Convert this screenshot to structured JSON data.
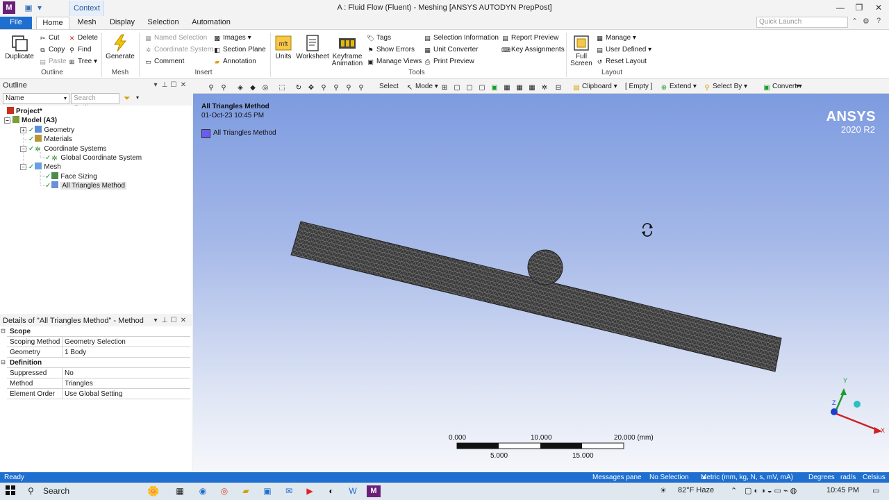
{
  "window": {
    "title": "A : Fluid Flow (Fluent) - Meshing [ANSYS AUTODYN PrepPost]",
    "context_tab": "Context",
    "app_logo": "M"
  },
  "ribbon_tabs": [
    "File",
    "Home",
    "Mesh",
    "Display",
    "Selection",
    "Automation"
  ],
  "quick_launch_placeholder": "Quick Launch",
  "ribbon": {
    "outline_group": {
      "duplicate": "Duplicate",
      "cut": "Cut",
      "copy": "Copy",
      "paste": "Paste",
      "delete": "Delete",
      "find": "Find",
      "tree": "Tree",
      "label": "Outline"
    },
    "mesh_group": {
      "generate": "Generate",
      "label": "Mesh"
    },
    "insert_group": {
      "named_selection": "Named Selection",
      "coordinate_system": "Coordinate System",
      "comment": "Comment",
      "images": "Images",
      "section_plane": "Section Plane",
      "annotation": "Annotation",
      "label": "Insert"
    },
    "tools_group": {
      "units": "Units",
      "worksheet": "Worksheet",
      "keyframe": "Keyframe",
      "animation": "Animation",
      "tags": "Tags",
      "show_errors": "Show Errors",
      "manage_views": "Manage Views",
      "selection_information": "Selection Information",
      "unit_converter": "Unit Converter",
      "print_preview": "Print Preview",
      "report_preview": "Report Preview",
      "key_assignments": "Key Assignments",
      "label": "Tools"
    },
    "layout_group": {
      "full": "Full",
      "screen": "Screen",
      "manage": "Manage",
      "user_defined": "User Defined",
      "reset_layout": "Reset Layout",
      "label": "Layout"
    }
  },
  "outline": {
    "title": "Outline",
    "name_filter": "Name",
    "search_placeholder": "Search Outline",
    "tree": [
      {
        "label": "Project*"
      },
      {
        "label": "Model (A3)"
      },
      {
        "label": "Geometry"
      },
      {
        "label": "Materials"
      },
      {
        "label": "Coordinate Systems"
      },
      {
        "label": "Global Coordinate System"
      },
      {
        "label": "Mesh"
      },
      {
        "label": "Face Sizing"
      },
      {
        "label": "All Triangles Method"
      }
    ]
  },
  "details": {
    "title": "Details of \"All Triangles Method\" - Method",
    "sections": [
      {
        "name": "Scope",
        "rows": [
          {
            "key": "Scoping Method",
            "value": "Geometry Selection"
          },
          {
            "key": "Geometry",
            "value": "1 Body"
          }
        ]
      },
      {
        "name": "Definition",
        "rows": [
          {
            "key": "Suppressed",
            "value": "No"
          },
          {
            "key": "Method",
            "value": "Triangles"
          },
          {
            "key": "Element Order",
            "value": "Use Global Setting"
          }
        ]
      }
    ]
  },
  "graphics_toolbar": {
    "select": "Select",
    "mode": "Mode",
    "clipboard": "Clipboard",
    "clipboard_state": "[ Empty ]",
    "extend": "Extend",
    "select_by": "Select By",
    "convert": "Convert"
  },
  "viewport": {
    "object_title": "All Triangles Method",
    "timestamp": "01-Oct-23 10:45 PM",
    "legend_label": "All Triangles Method",
    "legend_color": "#6b5cf0",
    "brand": "ANSYS",
    "version": "2020 R2",
    "scale_labels_top": [
      "0.000",
      "10.000",
      "20.000 (mm)"
    ],
    "scale_labels_bottom": [
      "5.000",
      "15.000"
    ],
    "triad": {
      "x": "X",
      "y": "Y",
      "z": "Z"
    }
  },
  "status": {
    "ready": "Ready",
    "messages_pane": "Messages pane",
    "no_selection": "No Selection",
    "units": "Metric (mm, kg, N, s, mV, mA)",
    "degrees": "Degrees",
    "rads": "rad/s",
    "temp_unit": "Celsius"
  },
  "taskbar": {
    "search": "Search",
    "weather": "82°F  Haze",
    "time": "10:45 PM"
  },
  "colors": {
    "accent": "#1e6fcf",
    "mesh": "#4a4a4a",
    "viewport_top": "#7d9be0"
  }
}
